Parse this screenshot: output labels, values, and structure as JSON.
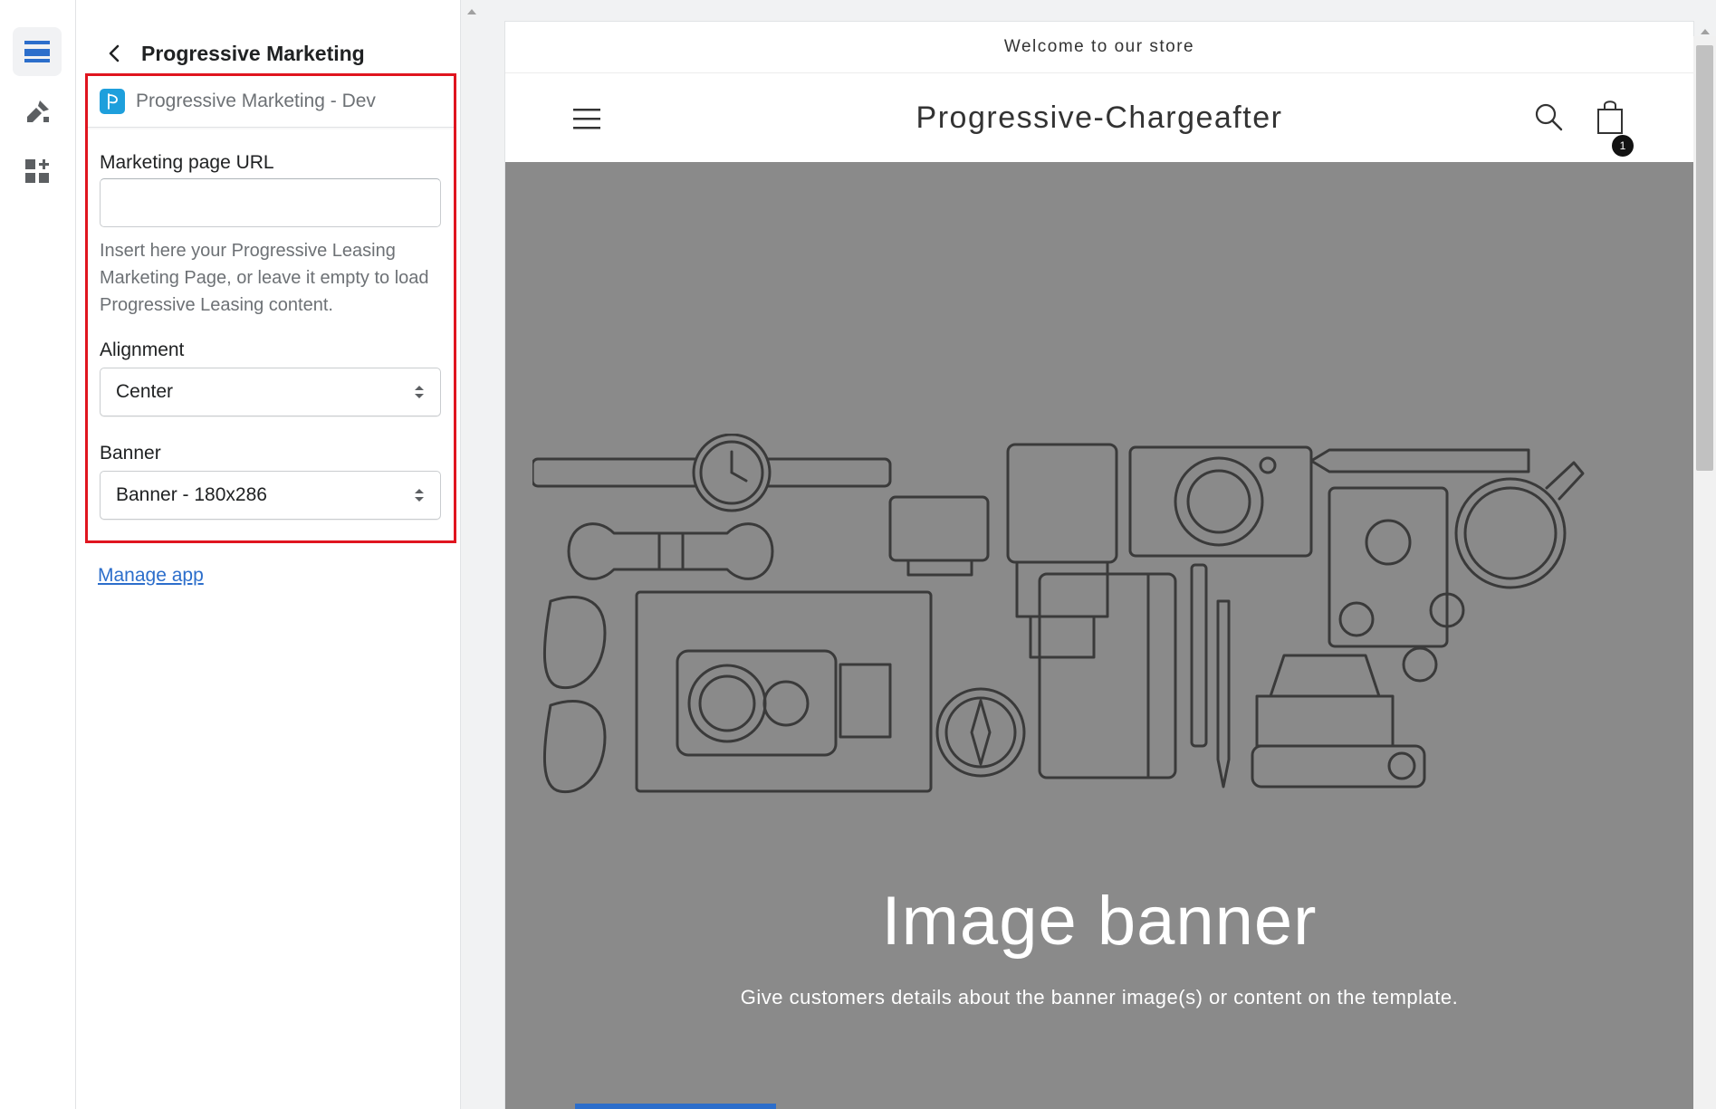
{
  "rail": {
    "items": [
      {
        "icon": "sections-icon",
        "active": true
      },
      {
        "icon": "theme-settings-icon",
        "active": false
      },
      {
        "icon": "app-embeds-icon",
        "active": false
      }
    ]
  },
  "panel": {
    "title": "Progressive Marketing",
    "app_name": "Progressive Marketing - Dev",
    "url_label": "Marketing page URL",
    "url_value": "",
    "url_help": "Insert here your Progressive Leasing Marketing Page, or leave it empty to load Progressive Leasing content.",
    "alignment_label": "Alignment",
    "alignment_value": "Center",
    "banner_label": "Banner",
    "banner_value": "Banner - 180x286",
    "manage_link": "Manage app"
  },
  "store": {
    "announcement": "Welcome to our store",
    "name": "Progressive-Chargeafter",
    "cart_count": "1",
    "banner_heading": "Image banner",
    "banner_text": "Give customers details about the banner image(s) or content on the template."
  },
  "colors": {
    "highlight": "#e0151f",
    "link": "#2c6ecb",
    "banner_bg": "#8a8a8a",
    "app_logo": "#1e9fdc"
  }
}
